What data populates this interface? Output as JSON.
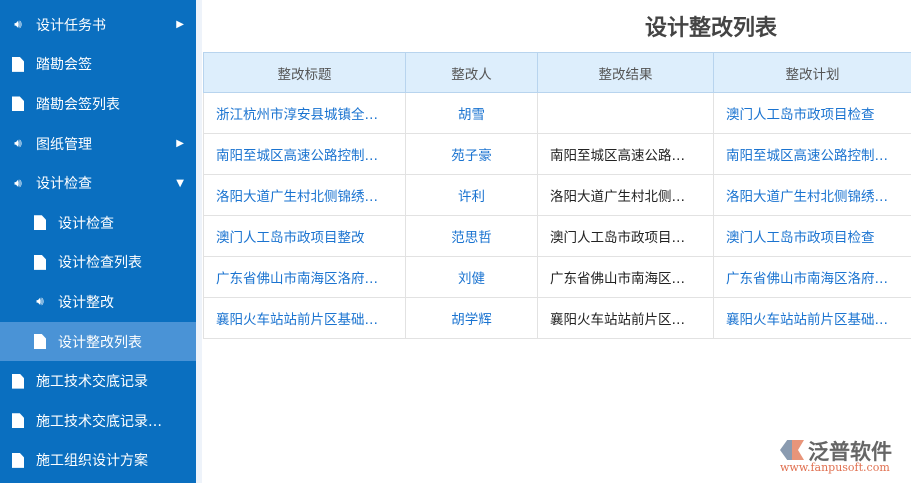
{
  "sidebar": {
    "items": [
      {
        "label": "设计任务书",
        "icon": "speaker-icon",
        "arrow": "▶"
      },
      {
        "label": "踏勘会签",
        "icon": "document-icon"
      },
      {
        "label": "踏勘会签列表",
        "icon": "document-icon"
      },
      {
        "label": "图纸管理",
        "icon": "speaker-icon",
        "arrow": "▶"
      },
      {
        "label": "设计检查",
        "icon": "speaker-icon",
        "arrow": "▼"
      },
      {
        "label": "设计检查",
        "icon": "document-icon",
        "sub": true
      },
      {
        "label": "设计检查列表",
        "icon": "document-icon",
        "sub": true
      },
      {
        "label": "设计整改",
        "icon": "speaker-icon",
        "sub": true
      },
      {
        "label": "设计整改列表",
        "icon": "document-icon",
        "sub": true,
        "active": true
      },
      {
        "label": "施工技术交底记录",
        "icon": "document-icon"
      },
      {
        "label": "施工技术交底记录…",
        "icon": "document-icon"
      },
      {
        "label": "施工组织设计方案",
        "icon": "document-icon"
      }
    ]
  },
  "page_title": "设计整改列表",
  "table": {
    "headers": [
      "整改标题",
      "整改人",
      "整改结果",
      "整改计划"
    ],
    "rows": [
      [
        "浙江杭州市淳安县城镇全…",
        "胡雪",
        "",
        "澳门人工岛市政项目检查"
      ],
      [
        "南阳至城区高速公路控制…",
        "苑子豪",
        "南阳至城区高速公路…",
        "南阳至城区高速公路控制…"
      ],
      [
        "洛阳大道广生村北侧锦绣…",
        "许利",
        "洛阳大道广生村北侧…",
        "洛阳大道广生村北侧锦绣…"
      ],
      [
        "澳门人工岛市政项目整改",
        "范思哲",
        "澳门人工岛市政项目…",
        "澳门人工岛市政项目检查"
      ],
      [
        "广东省佛山市南海区洛府…",
        "刘健",
        "广东省佛山市南海区…",
        "广东省佛山市南海区洛府…"
      ],
      [
        "襄阳火车站站前片区基础…",
        "胡学辉",
        "襄阳火车站站前片区…",
        "襄阳火车站站前片区基础…"
      ]
    ]
  },
  "logo": {
    "name": "泛普软件",
    "url": "www.fanpusoft.com"
  }
}
